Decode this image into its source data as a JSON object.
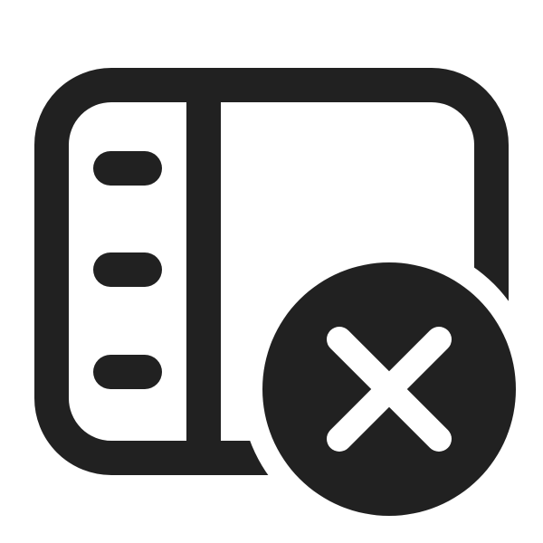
{
  "icon": {
    "name": "panel-left-dismiss-icon",
    "parts": [
      "window-frame",
      "sidebar-divider",
      "sidebar-lines",
      "dismiss-badge"
    ],
    "colors": {
      "stroke": "#212121",
      "background": "#ffffff",
      "badge_fill": "#212121",
      "badge_glyph": "#ffffff"
    }
  }
}
